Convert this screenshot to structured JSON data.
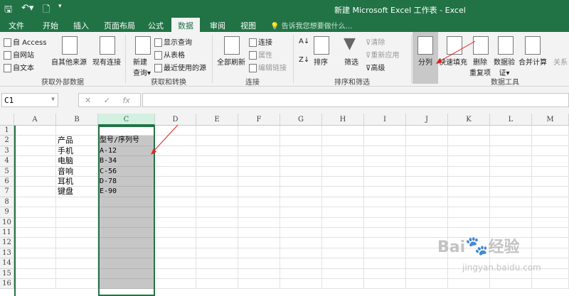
{
  "title_bar": {
    "title": "新建 Microsoft Excel 工作表 - Excel"
  },
  "tabs": [
    "文件",
    "开始",
    "插入",
    "页面布局",
    "公式",
    "数据",
    "审阅",
    "视图"
  ],
  "active_tab": "数据",
  "tell_me": "告诉我您想要做什么...",
  "ribbon": {
    "get_external": {
      "items": [
        "自 Access",
        "自网站",
        "自文本",
        "自其他来源",
        "现有连接"
      ],
      "label": "获取外部数据"
    },
    "get_transform": {
      "new_query": [
        "新建",
        "查询"
      ],
      "items": [
        "显示查询",
        "从表格",
        "最近使用的源"
      ],
      "label": "获取和转换"
    },
    "connections": {
      "refresh": "全部刷新",
      "items": [
        "连接",
        "属性",
        "编辑链接"
      ],
      "label": "连接"
    },
    "sort_filter": {
      "sort": "排序",
      "filter": "筛选",
      "items": [
        "清除",
        "重新应用",
        "高级"
      ],
      "label": "排序和筛选"
    },
    "data_tools": {
      "items": [
        "分列",
        "快速填充",
        "删除",
        "重复项",
        "数据验",
        "证",
        "合并计算",
        "关系"
      ],
      "label": "数据工具"
    }
  },
  "formula_bar": {
    "name_box": "C1",
    "value": ""
  },
  "columns": [
    "A",
    "B",
    "C",
    "D",
    "E",
    "F",
    "G",
    "H",
    "I",
    "J",
    "K",
    "L",
    "M"
  ],
  "rows": [
    "1",
    "2",
    "3",
    "4",
    "5",
    "6",
    "7",
    "8",
    "9",
    "10",
    "11",
    "12",
    "13",
    "14",
    "15",
    "16"
  ],
  "cells": {
    "B": [
      "",
      "产品",
      "手机",
      "电脑",
      "音响",
      "耳机",
      "键盘"
    ],
    "C": [
      "",
      "型号/序列号",
      "A-12",
      "B-34",
      "C-56",
      "D-78",
      "E-90"
    ]
  },
  "watermark": {
    "brand": "Bai 经验",
    "url": "jingyan.baidu.com"
  },
  "annotation_color": "#e02020"
}
